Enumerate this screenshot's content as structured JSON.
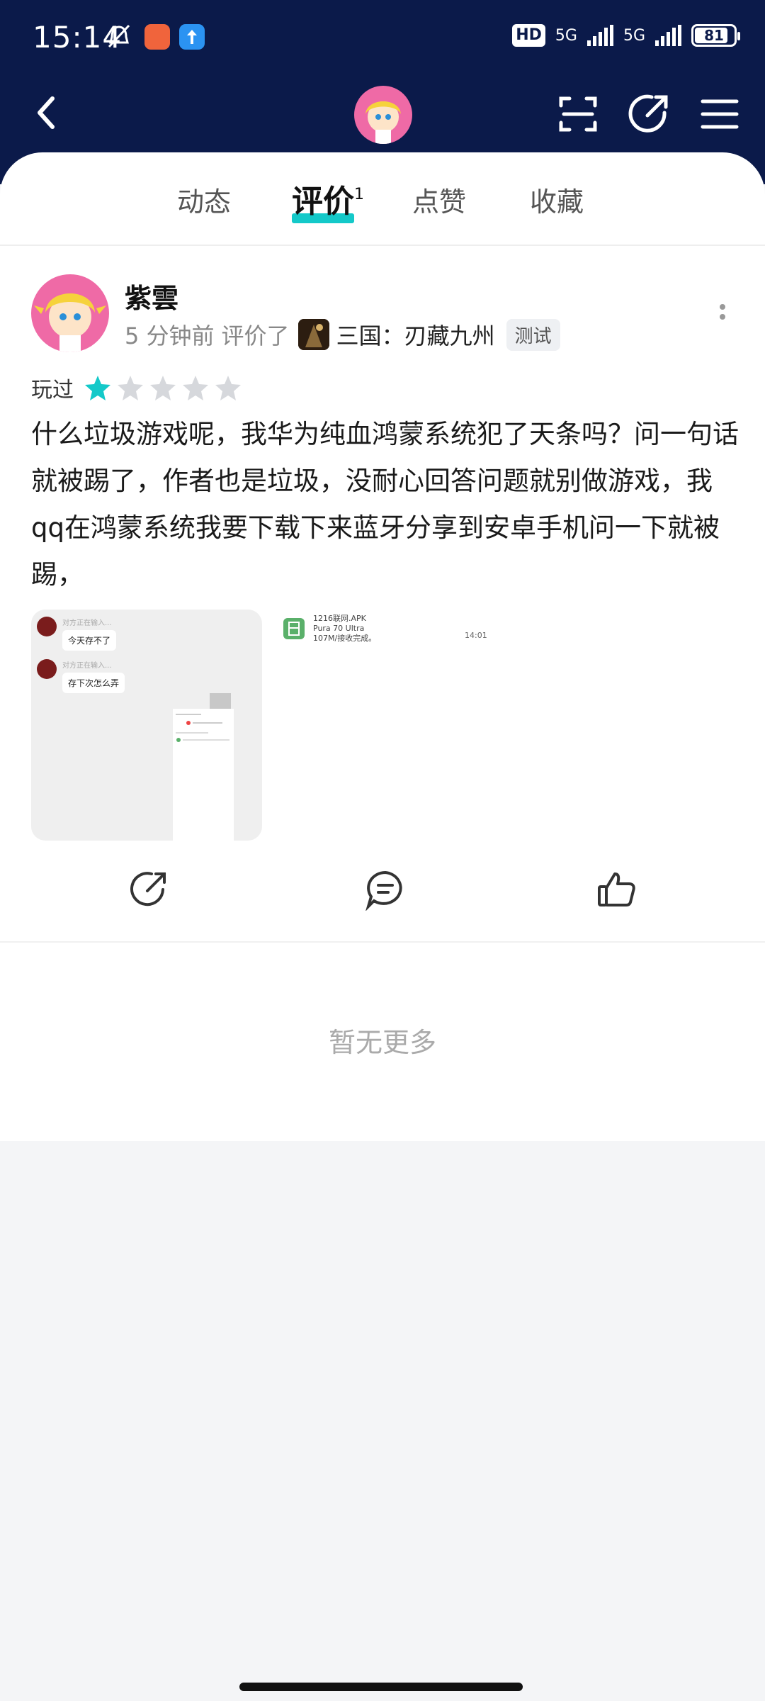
{
  "status_bar": {
    "time": "15:14",
    "hd_label": "HD",
    "net_label_1": "5G",
    "net_label_2": "5G",
    "battery": "81"
  },
  "tabs": [
    {
      "label": "动态"
    },
    {
      "label": "评价",
      "count": "1"
    },
    {
      "label": "点赞"
    },
    {
      "label": "收藏"
    }
  ],
  "review": {
    "username": "紫雲",
    "time_ago": "5 分钟前",
    "action": "评价了",
    "game_name": "三国：刃藏九州",
    "game_tag": "测试",
    "played_label": "玩过",
    "rating": 1,
    "rating_max": 5,
    "text": "什么垃圾游戏呢，我华为纯血鸿蒙系统犯了天条吗？问一句话就被踢了，作者也是垃圾，没耐心回答问题就别做游戏，我qq在鸿蒙系统我要下载下来蓝牙分享到安卓手机问一下就被踢，"
  },
  "images": {
    "img1": {
      "hint1": "对方正在输入...",
      "msg1": "今天存不了",
      "hint2": "对方正在输入...",
      "msg2": "存下次怎么弄"
    },
    "img2": {
      "file_name": "1216联网.APK",
      "file_device": "Pura 70 Ultra",
      "file_status": "107M/接收完成。",
      "time": "14:01"
    }
  },
  "footer": {
    "no_more": "暂无更多"
  },
  "colors": {
    "header_bg": "#0b1a4a",
    "accent": "#14c9c9",
    "avatar_bg": "#ef6aa6"
  }
}
